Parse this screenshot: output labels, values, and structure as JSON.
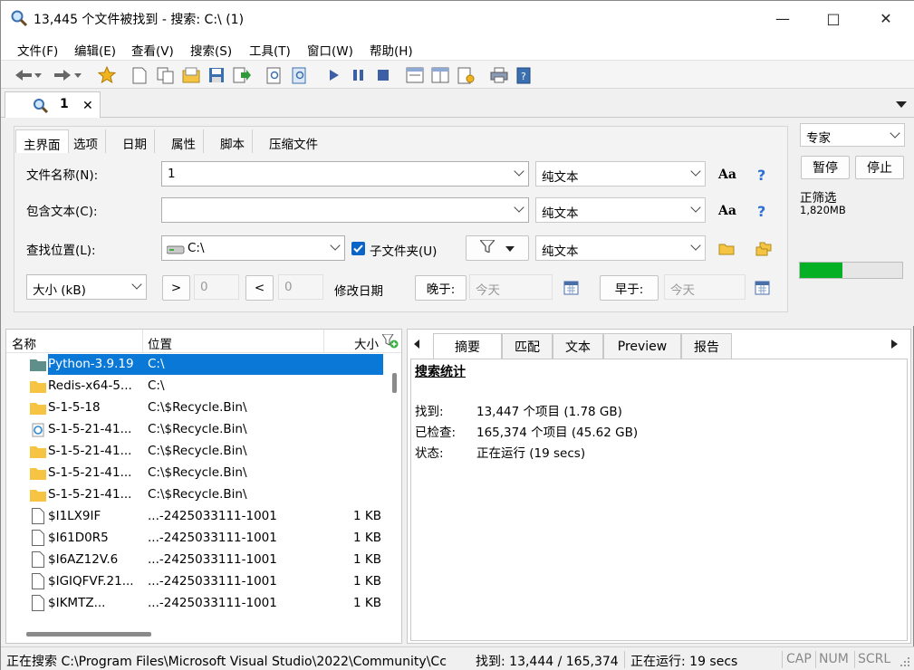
{
  "window": {
    "title": "13,445 个文件被找到 - 搜索: C:\\ (1)",
    "minimize": "—",
    "maximize": "□",
    "close": "✕"
  },
  "menu": [
    "文件(F)",
    "编辑(E)",
    "查看(V)",
    "搜索(S)",
    "工具(T)",
    "窗口(W)",
    "帮助(H)"
  ],
  "doc_tab": {
    "label": "1",
    "close": "✕"
  },
  "search_tabs": [
    "主界面",
    "选项",
    "日期",
    "属性",
    "脚本",
    "压缩文件"
  ],
  "filename": {
    "label": "文件名称(N):",
    "value": "1",
    "mode": "纯文本"
  },
  "contains": {
    "label": "包含文本(C):",
    "value": "",
    "mode": "纯文本"
  },
  "location": {
    "label": "查找位置(L):",
    "value": "C:\\",
    "subfolders": "子文件夹(U)",
    "subfolders_checked": true,
    "mode": "纯文本"
  },
  "size_filter": {
    "field": "大小 (kB)",
    "gt": ">",
    "gt_value": "0",
    "lt": "<",
    "lt_value": "0"
  },
  "date_filter": {
    "label": "修改日期",
    "after": "晚于:",
    "after_value": "今天",
    "before": "早于:",
    "before_value": "今天"
  },
  "aa_label": "Aa",
  "help_label": "?",
  "side": {
    "mode": "专家",
    "pause": "暂停",
    "stop": "停止",
    "status": "正筛选",
    "memory": "1,820MB",
    "progress": 0.42
  },
  "results": {
    "columns": {
      "name": "名称",
      "location": "位置",
      "size": "大小"
    },
    "rows": [
      {
        "name": "Python-3.9.19",
        "location": "C:\\",
        "size": "",
        "icon": "folder-teal-icon"
      },
      {
        "name": "Redis-x64-5...",
        "location": "C:\\",
        "size": "",
        "icon": "folder-icon"
      },
      {
        "name": "S-1-5-18",
        "location": "C:\\$Recycle.Bin\\",
        "size": "",
        "icon": "folder-icon"
      },
      {
        "name": "S-1-5-21-41...",
        "location": "C:\\$Recycle.Bin\\",
        "size": "",
        "icon": "recycle-bin-icon"
      },
      {
        "name": "S-1-5-21-41...",
        "location": "C:\\$Recycle.Bin\\",
        "size": "",
        "icon": "folder-icon"
      },
      {
        "name": "S-1-5-21-41...",
        "location": "C:\\$Recycle.Bin\\",
        "size": "",
        "icon": "folder-icon"
      },
      {
        "name": "S-1-5-21-41...",
        "location": "C:\\$Recycle.Bin\\",
        "size": "",
        "icon": "folder-icon"
      },
      {
        "name": "$I1LX9IF",
        "location": "...-2425033111-1001",
        "size": "1 KB",
        "icon": "file-icon"
      },
      {
        "name": "$I61D0R5",
        "location": "...-2425033111-1001",
        "size": "1 KB",
        "icon": "file-icon"
      },
      {
        "name": "$I6AZ12V.6",
        "location": "...-2425033111-1001",
        "size": "1 KB",
        "icon": "file-icon"
      },
      {
        "name": "$IGIQFVF.21...",
        "location": "...-2425033111-1001",
        "size": "1 KB",
        "icon": "file-icon"
      },
      {
        "name": "$IKMTZ...",
        "location": "...-2425033111-1001",
        "size": "1 KB",
        "icon": "file-icon"
      }
    ]
  },
  "preview": {
    "tabs": [
      "摘要",
      "匹配",
      "文本",
      "Preview",
      "报告"
    ],
    "heading": "搜索统计",
    "stats": [
      {
        "label": "找到:",
        "value": "13,447 个项目 (1.78 GB)"
      },
      {
        "label": "已检查:",
        "value": "165,374 个项目 (45.62 GB)"
      },
      {
        "label": "状态:",
        "value": "正在运行 (19 secs)"
      }
    ]
  },
  "status": {
    "searching": "正在搜索 C:\\Program Files\\Microsoft Visual Studio\\2022\\Community\\Cc",
    "found": "找到: 13,444 / 165,374",
    "running": "正在运行: 19 secs",
    "cap": "CAP",
    "num": "NUM",
    "scrl": "SCRL"
  }
}
